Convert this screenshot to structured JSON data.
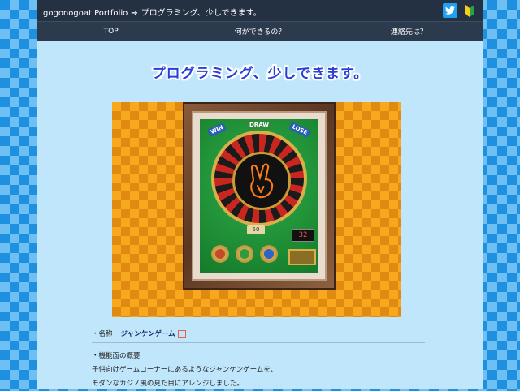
{
  "header": {
    "site_name": "gogonogoat Portfolio",
    "arrow": "➔",
    "current_page": "プログラミング、少しできます。",
    "icons": [
      "twitter-icon",
      "beginner-mark-icon"
    ]
  },
  "nav": {
    "items": [
      {
        "label": "TOP"
      },
      {
        "label": "何ができるの？"
      },
      {
        "label": "連絡先は？"
      }
    ]
  },
  "main": {
    "title": "プログラミング、少しできます。",
    "game_ui": {
      "win": "WIN",
      "draw": "DRAW",
      "lose": "LOSE",
      "counter": "50",
      "timer": "32"
    },
    "name_label": "・名称",
    "game_name": "ジャンケンゲーム",
    "features_label": "・機能面の概要",
    "features_line1": "子供向けゲームコーナーにあるようなジャンケンゲームを、",
    "features_line2": "モダンなカジノ風の見た目にアレンジしました。"
  },
  "colors": {
    "nav_bg": "#2b3a4c",
    "content_bg": "#bfe6fb",
    "title_color": "#2a3fd8",
    "twitter": "#1da1f2",
    "argyle_orange": "#f7a81c"
  }
}
